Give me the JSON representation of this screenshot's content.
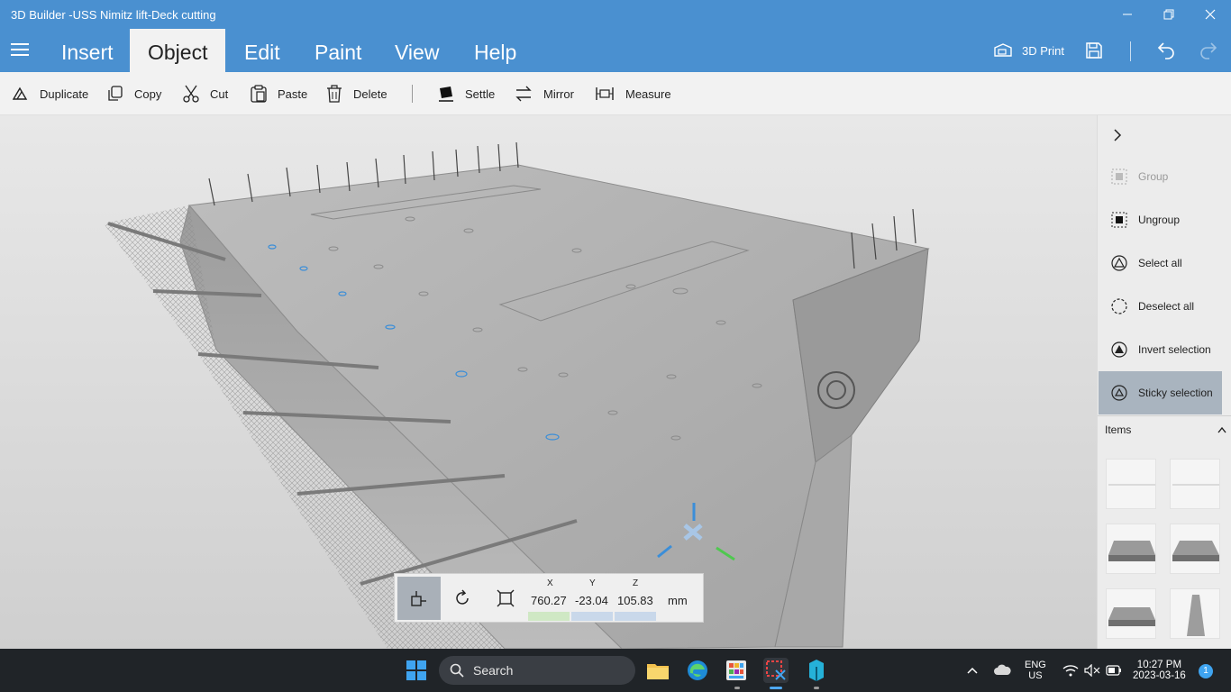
{
  "window": {
    "title": "3D Builder -USS Nimitz lift-Deck cutting",
    "controls": [
      "minimize",
      "maximize",
      "close"
    ]
  },
  "menu": {
    "tabs": [
      "Insert",
      "Object",
      "Edit",
      "Paint",
      "View",
      "Help"
    ],
    "active_tab": "Object",
    "print_label": "3D Print"
  },
  "toolbar": {
    "duplicate": "Duplicate",
    "copy": "Copy",
    "cut": "Cut",
    "paste": "Paste",
    "delete": "Delete",
    "settle": "Settle",
    "mirror": "Mirror",
    "measure": "Measure"
  },
  "panel": {
    "group": "Group",
    "ungroup": "Ungroup",
    "select_all": "Select all",
    "deselect_all": "Deselect all",
    "invert_selection": "Invert selection",
    "sticky_selection": "Sticky selection",
    "items_header": "Items"
  },
  "coords": {
    "x_label": "X",
    "y_label": "Y",
    "z_label": "Z",
    "x": "760.27",
    "y": "-23.04",
    "z": "105.83",
    "unit": "mm"
  },
  "taskbar": {
    "search_placeholder": "Search",
    "lang_top": "ENG",
    "lang_bottom": "US",
    "time": "10:27 PM",
    "date": "2023-03-16",
    "notification_count": "1"
  },
  "colors": {
    "accent": "#4a90d0",
    "selected": "#a9b4bf",
    "taskbar": "#202428"
  }
}
